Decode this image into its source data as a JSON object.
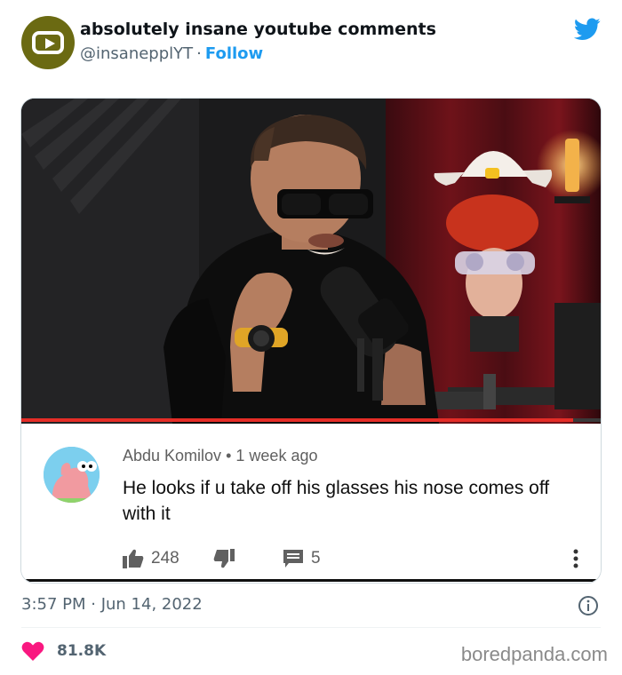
{
  "tweet": {
    "display_name": "absolutely insane youtube comments",
    "handle": "@insanepplYT",
    "separator": "·",
    "follow_label": "Follow",
    "timestamp": "3:57 PM · Jun 14, 2022",
    "like_count": "81.8K",
    "brand_color": "#1d9bf0"
  },
  "comment": {
    "author": "Abdu Komilov",
    "age": "1 week ago",
    "text": "He looks if u take off his glasses his nose comes off with it",
    "like_count": "248",
    "reply_count": "5"
  },
  "video": {
    "progress_fraction": 0.95
  },
  "watermark": "boredpanda.com",
  "icons": {
    "brand": "twitter-bird-icon",
    "channel": "youtube-logo-icon",
    "like": "thumbs-up-icon",
    "dislike": "thumbs-down-icon",
    "replies": "comment-icon",
    "more": "vertical-dots-icon",
    "info": "info-icon",
    "heart": "heart-icon"
  }
}
